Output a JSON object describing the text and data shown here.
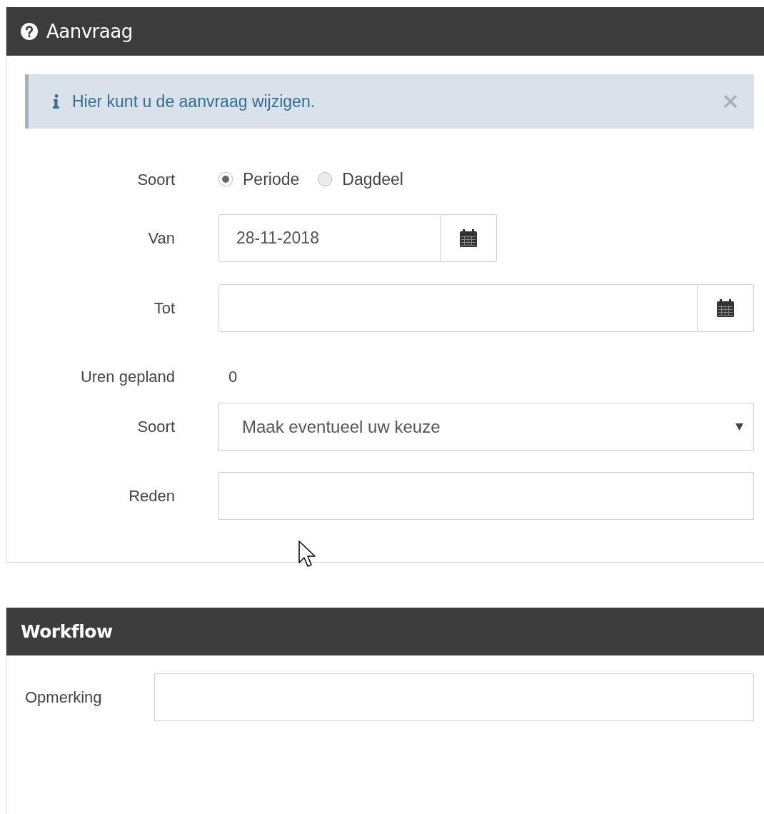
{
  "request_panel": {
    "title": "Aanvraag",
    "alert": {
      "text": "Hier kunt u de aanvraag wijzigen.",
      "dismissible": true
    },
    "fields": [
      {
        "kind": "radio",
        "label": "Soort",
        "options": [
          {
            "label": "Periode",
            "selected": true
          },
          {
            "label": "Dagdeel",
            "selected": false
          }
        ]
      },
      {
        "kind": "date",
        "label": "Van",
        "value": "28-11-2018",
        "compact": true
      },
      {
        "kind": "date",
        "label": "Tot",
        "compact": false
      },
      {
        "kind": "static",
        "label": "Uren gepland",
        "value": "0"
      },
      {
        "kind": "select",
        "label": "Soort",
        "placeholder": "Maak eventueel uw keuze"
      },
      {
        "kind": "text",
        "label": "Reden"
      }
    ]
  },
  "workflow_panel": {
    "title": "Workflow",
    "fields": [
      {
        "kind": "text",
        "label": "Opmerking"
      }
    ]
  }
}
